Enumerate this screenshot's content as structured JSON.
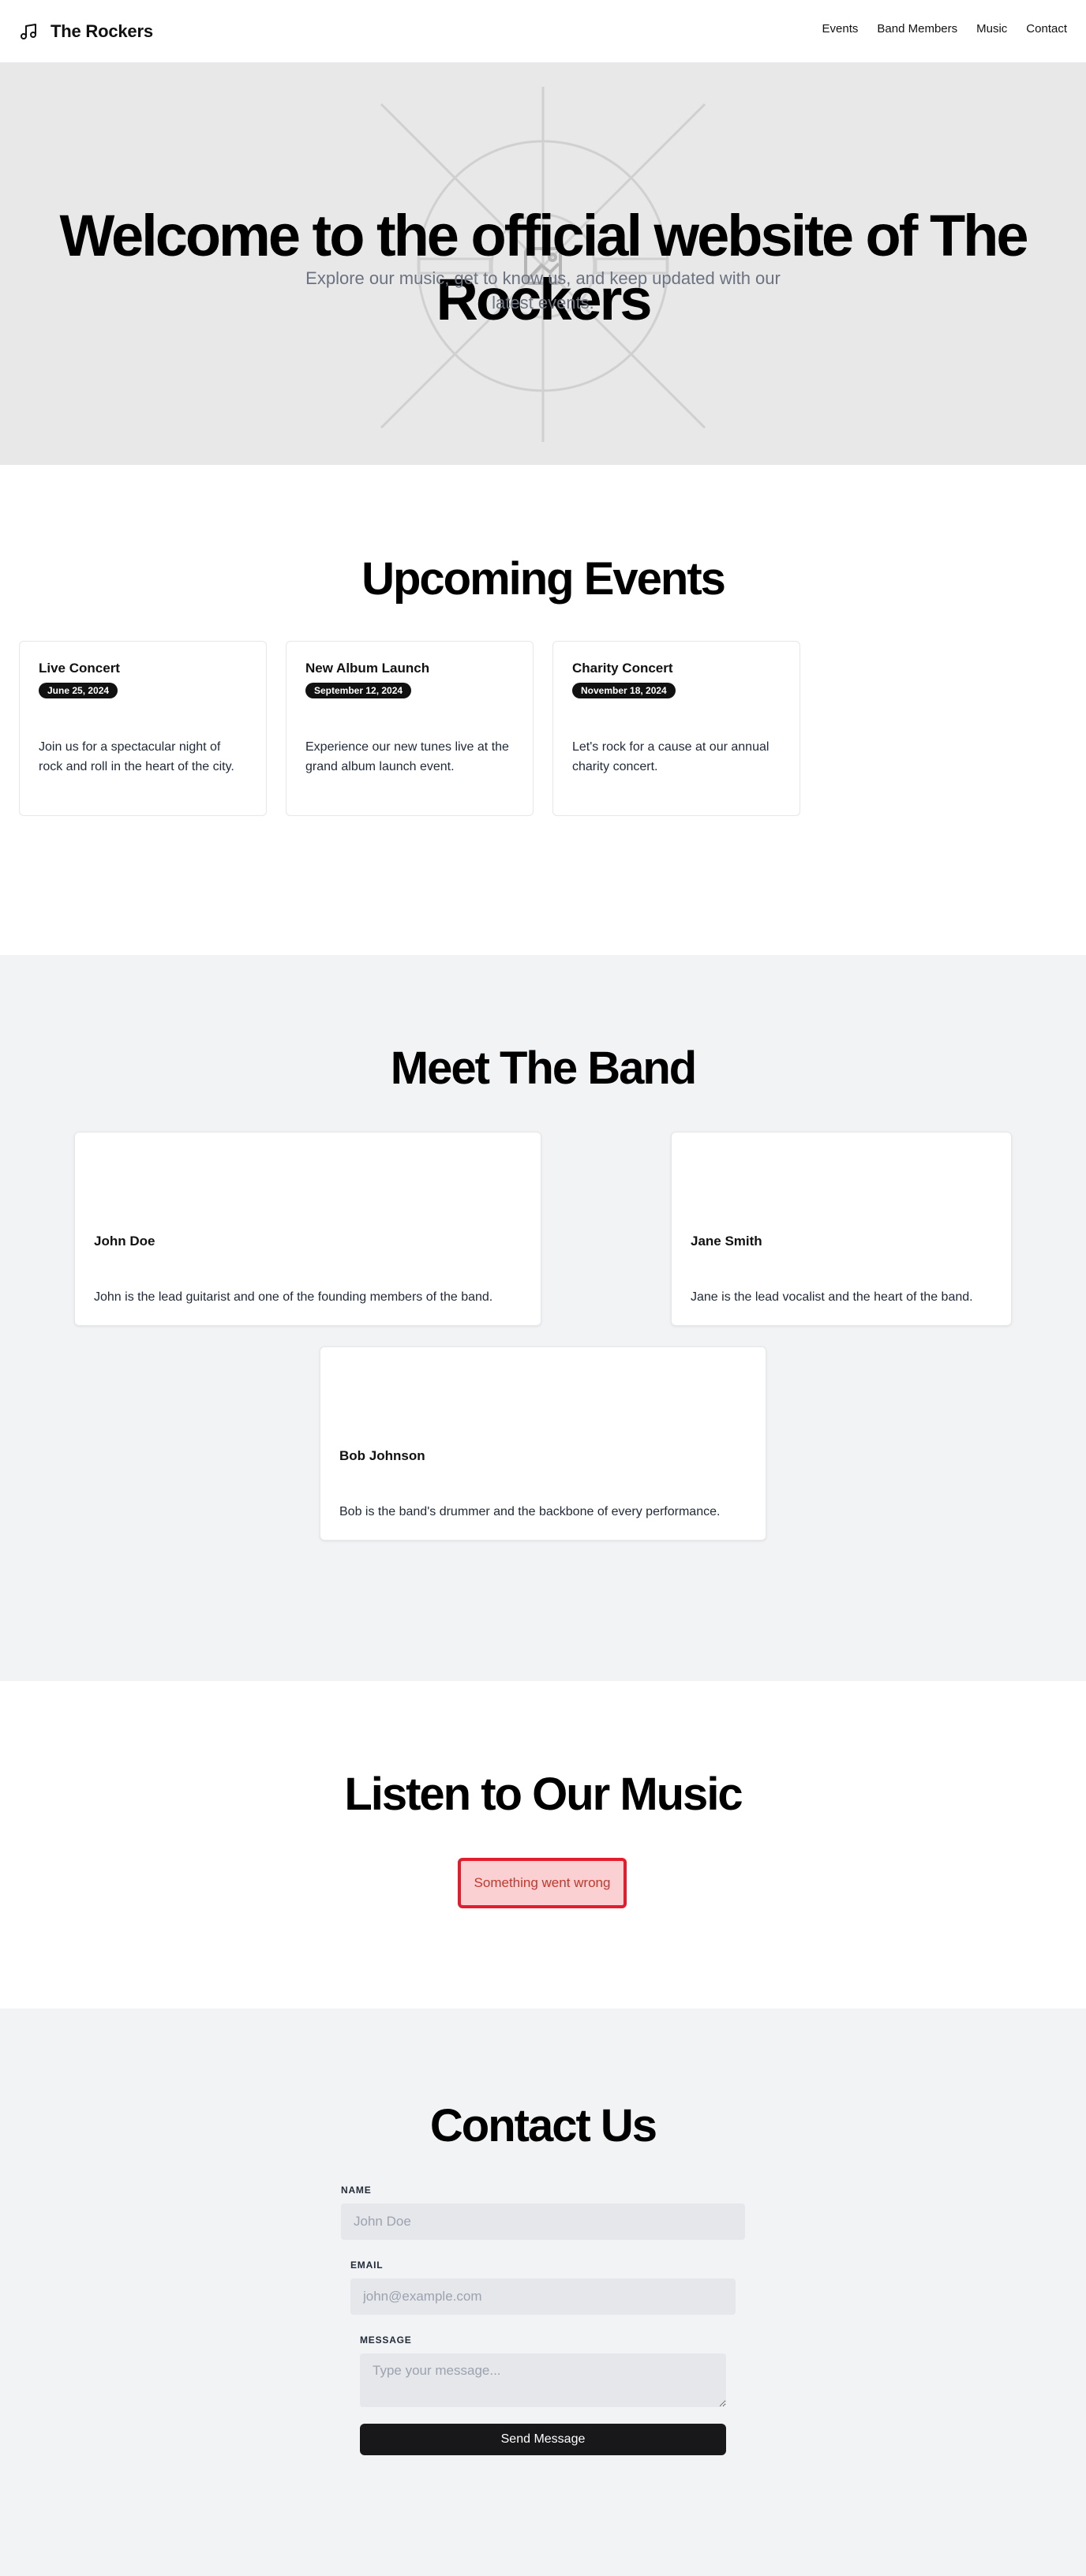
{
  "header": {
    "brand": "The Rockers",
    "brand_icon": "music-note-icon",
    "nav": [
      "Events",
      "Band Members",
      "Music",
      "Contact"
    ]
  },
  "hero": {
    "title": "Welcome to the official website of The Rockers",
    "subtitle": "Explore our music, get to know us, and keep updated with our latest events.",
    "image_icon": "image-placeholder-icon"
  },
  "events": {
    "title": "Upcoming Events",
    "items": [
      {
        "name": "Live Concert",
        "date": "June 25, 2024",
        "description": "Join us for a spectacular night of rock and roll in the heart of the city."
      },
      {
        "name": "New Album Launch",
        "date": "September 12, 2024",
        "description": "Experience our new tunes live at the grand album launch event."
      },
      {
        "name": "Charity Concert",
        "date": "November 18, 2024",
        "description": "Let's rock for a cause at our annual charity concert."
      }
    ]
  },
  "band": {
    "title": "Meet The Band",
    "members": [
      {
        "name": "John Doe",
        "bio": "John is the lead guitarist and one of the founding members of the band."
      },
      {
        "name": "Jane Smith",
        "bio": "Jane is the lead vocalist and the heart of the band."
      },
      {
        "name": "Bob Johnson",
        "bio": "Bob is the band's drummer and the backbone of every performance."
      }
    ]
  },
  "music": {
    "title": "Listen to Our Music",
    "error": "Something went wrong"
  },
  "contact": {
    "title": "Contact Us",
    "name_label": "NAME",
    "name_placeholder": "John Doe",
    "email_label": "EMAIL",
    "email_placeholder": "john@example.com",
    "message_label": "MESSAGE",
    "message_placeholder": "Type your message...",
    "submit": "Send Message"
  },
  "colors": {
    "accent": "#111111",
    "hero_bg": "#e8e8e8",
    "section_bg": "#f2f3f5",
    "error_border": "#e11d2e",
    "error_bg": "#fbd0d3"
  }
}
